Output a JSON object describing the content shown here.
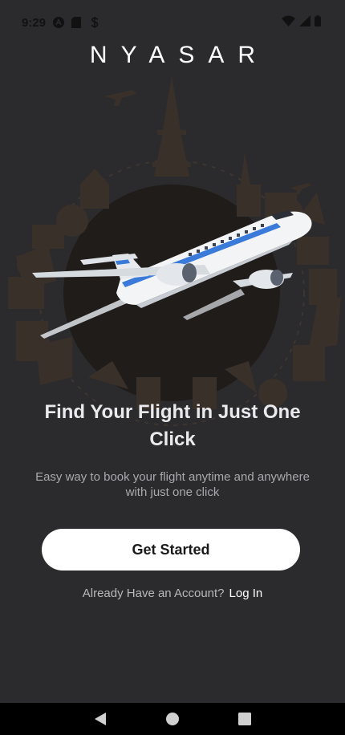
{
  "status_bar": {
    "time": "9:29",
    "left_icons": [
      "a-logo-icon",
      "sd-card-icon",
      "dollar-icon"
    ],
    "right_icons": [
      "wifi-icon",
      "signal-icon",
      "battery-icon"
    ]
  },
  "brand": {
    "name": "NYASAR"
  },
  "hero": {
    "illustration": "airplane-over-world-landmarks-illustration"
  },
  "content": {
    "headline": "Find Your Flight in Just One Click",
    "subtext": "Easy way to book your flight anytime and anywhere with just one click"
  },
  "actions": {
    "primary_label": "Get Started",
    "account_prompt": "Already Have an Account?",
    "login_label": "Log In"
  },
  "nav_bar": {
    "buttons": [
      "back-icon",
      "home-icon",
      "recents-icon"
    ]
  },
  "colors": {
    "background": "#2b2b2d",
    "primary_button": "#ffffff",
    "accent_stripe": "#3a7ad9"
  }
}
